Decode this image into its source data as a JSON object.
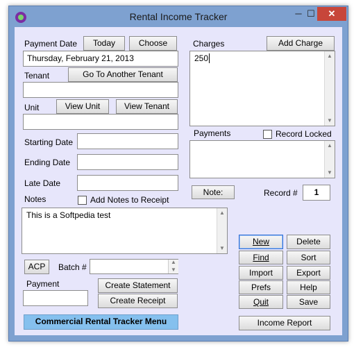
{
  "window": {
    "title": "Rental Income Tracker",
    "close_glyph": "✕",
    "min_glyph": "─",
    "max_glyph": "☐"
  },
  "payment_date": {
    "label": "Payment Date",
    "today_btn": "Today",
    "choose_btn": "Choose",
    "value": "Thursday, February 21, 2013"
  },
  "tenant": {
    "label": "Tenant",
    "goto_btn": "Go To Another Tenant",
    "value": ""
  },
  "unit": {
    "label": "Unit",
    "view_unit_btn": "View Unit",
    "view_tenant_btn": "View Tenant",
    "value": ""
  },
  "starting_date": {
    "label": "Starting Date",
    "value": ""
  },
  "ending_date": {
    "label": "Ending Date",
    "value": ""
  },
  "late_date": {
    "label": "Late Date",
    "value": ""
  },
  "notes": {
    "label": "Notes",
    "add_to_receipt_label": "Add Notes to Receipt",
    "value": "This is a Softpedia test"
  },
  "acp_btn": "ACP",
  "batch": {
    "label": "Batch #",
    "value": ""
  },
  "payment": {
    "label": "Payment",
    "value": ""
  },
  "create_statement_btn": "Create Statement",
  "create_receipt_btn": "Create Receipt",
  "commercial_menu_btn": "Commercial Rental Tracker Menu",
  "charges": {
    "label": "Charges",
    "add_btn": "Add Charge",
    "value": "250"
  },
  "payments": {
    "label": "Payments",
    "record_locked_label": "Record Locked",
    "value": ""
  },
  "note_btn": "Note:",
  "record": {
    "label": "Record #",
    "value": "1"
  },
  "actions": {
    "new": "New",
    "delete": "Delete",
    "find": "Find",
    "sort": "Sort",
    "import": "Import",
    "export": "Export",
    "prefs": "Prefs",
    "help": "Help",
    "quit": "Quit",
    "save": "Save"
  },
  "income_report_btn": "Income Report",
  "colors": {
    "window_frame": "#7ea1d0",
    "client_bg": "#e7e6fb",
    "close_btn": "#c7463a",
    "menu_btn": "#85c0ee"
  }
}
